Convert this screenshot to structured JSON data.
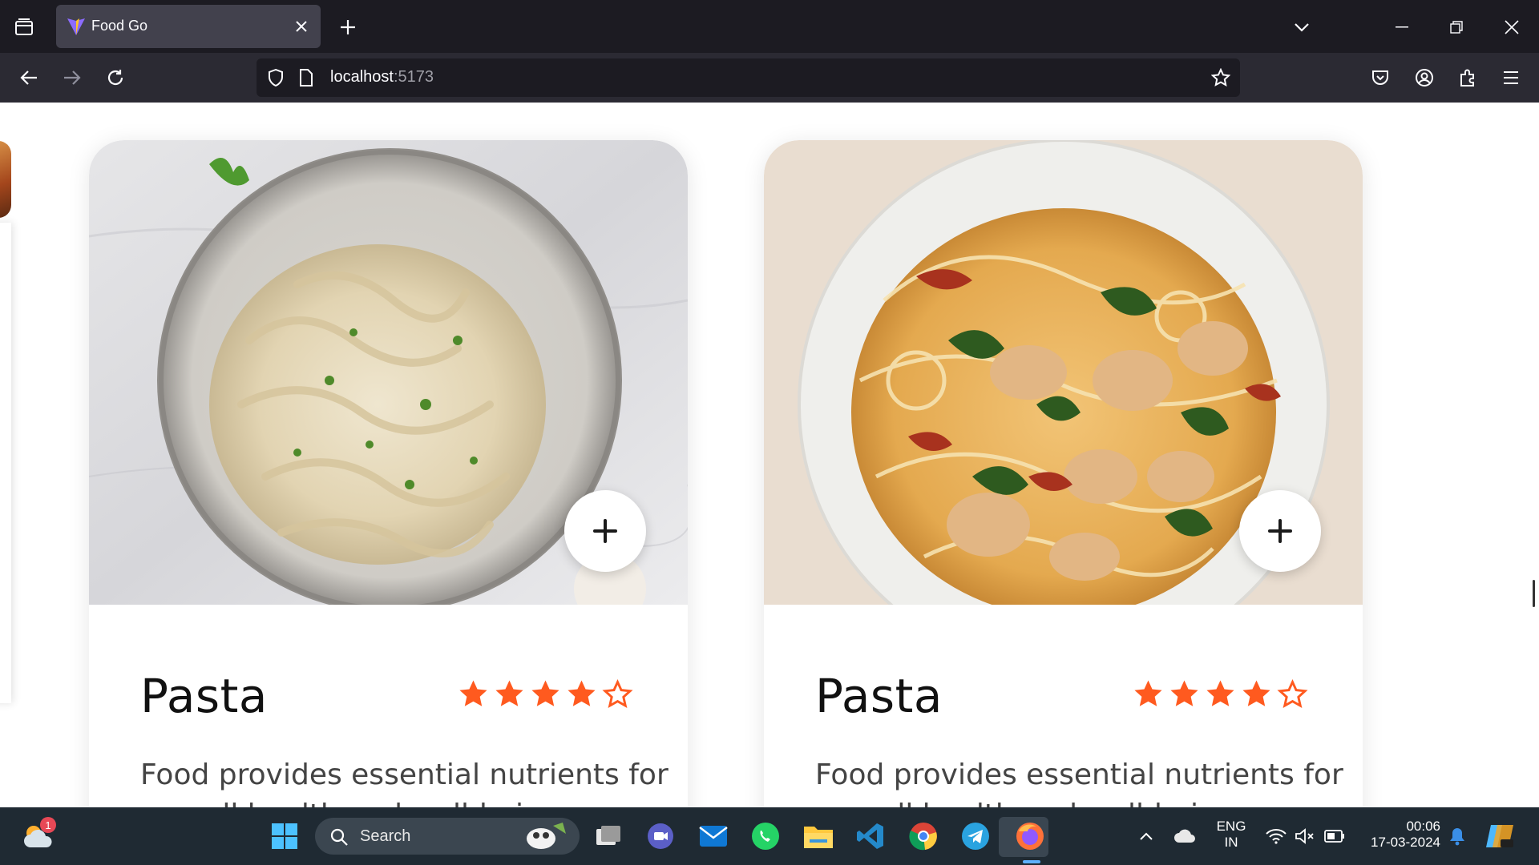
{
  "browser": {
    "tab_title": "Food Go",
    "url_host": "localhost",
    "url_port": ":5173"
  },
  "cards": [
    {
      "title": "Pasta",
      "rating": 4,
      "rating_max": 5,
      "description_line1": "Food provides essential nutrients for",
      "description_line2": "overall health and well-being."
    },
    {
      "title": "Pasta",
      "rating": 4,
      "rating_max": 5,
      "description_line1": "Food provides essential nutrients for",
      "description_line2": "overall health and well-being."
    }
  ],
  "colors": {
    "star": "#ff5a1f",
    "accent": "#ff5a1f"
  },
  "taskbar": {
    "search_label": "Search",
    "weather_badge": "1",
    "lang_top": "ENG",
    "lang_bottom": "IN",
    "time": "00:06",
    "date": "17-03-2024"
  }
}
